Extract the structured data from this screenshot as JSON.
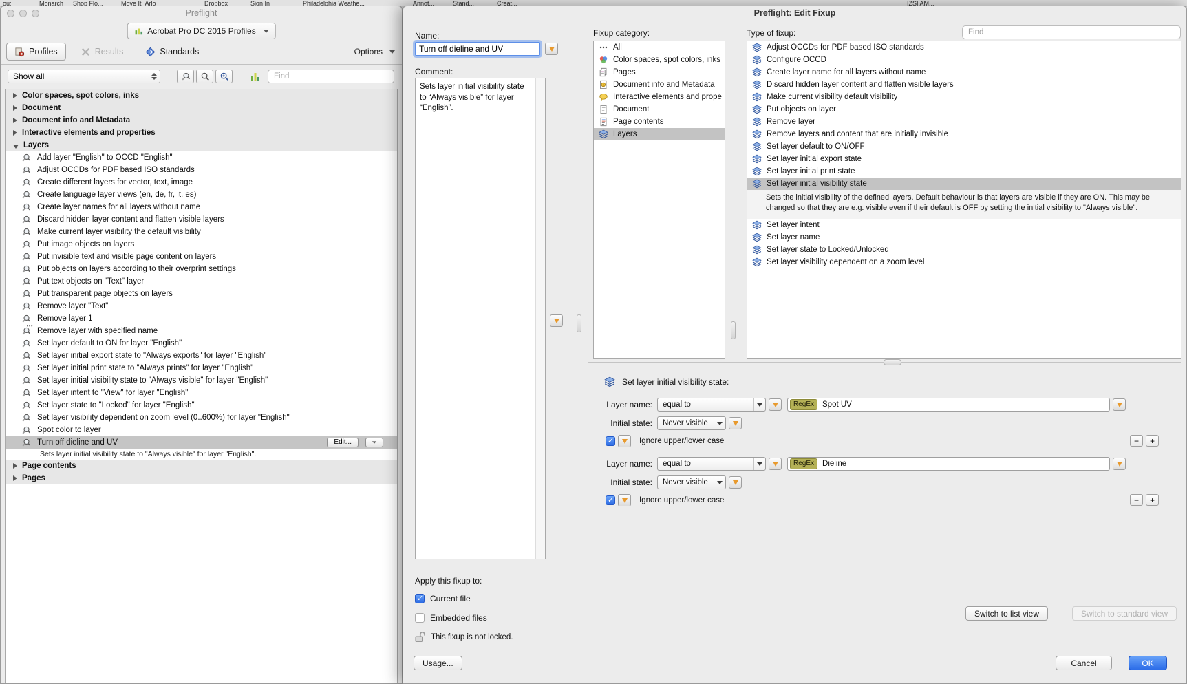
{
  "background": {
    "left_items": [
      "ou:",
      "Monarch",
      "Shop Flo...",
      "Move It_Arlo",
      "Dropbox",
      "Sign In",
      "Philadelphia Weathe..."
    ],
    "right_items": [
      "Annot...",
      "Stand...",
      "Creat...",
      "IZSI AM..."
    ]
  },
  "preflight_window": {
    "title": "Preflight",
    "profiles_dropdown_label": "Acrobat Pro DC 2015 Profiles",
    "tabs": [
      {
        "label": "Profiles"
      },
      {
        "label": "Results"
      },
      {
        "label": "Standards"
      }
    ],
    "options_label": "Options",
    "show_all_value": "Show all",
    "find_placeholder": "Find",
    "edit_button_label": "Edit...",
    "tree": [
      {
        "type": "category",
        "label": "Color spaces, spot colors, inks",
        "expanded": false
      },
      {
        "type": "category",
        "label": "Document",
        "expanded": false
      },
      {
        "type": "category",
        "label": "Document info and Metadata",
        "expanded": false
      },
      {
        "type": "category",
        "label": "Interactive elements and properties",
        "expanded": false
      },
      {
        "type": "category",
        "label": "Layers",
        "expanded": true
      },
      {
        "type": "item",
        "label": "Add layer \"English\" to OCCD \"English\""
      },
      {
        "type": "item",
        "label": "Adjust OCCDs for PDF based ISO standards"
      },
      {
        "type": "item",
        "label": "Create different layers for vector, text, image"
      },
      {
        "type": "item",
        "label": "Create language layer views (en, de, fr, it, es)"
      },
      {
        "type": "item",
        "label": "Create layer names for all layers without name"
      },
      {
        "type": "item",
        "label": "Discard hidden layer content and flatten visible layers"
      },
      {
        "type": "item",
        "label": "Make current layer visibility the default visibility"
      },
      {
        "type": "item",
        "label": "Put image objects on layers"
      },
      {
        "type": "item",
        "label": "Put invisible text and visible page content on layers"
      },
      {
        "type": "item",
        "label": "Put objects on layers according to their overprint settings"
      },
      {
        "type": "item",
        "label": "Put text objects on \"Text\" layer"
      },
      {
        "type": "item",
        "label": "Put transparent page objects on layers"
      },
      {
        "type": "item",
        "label": "Remove layer \"Text\""
      },
      {
        "type": "item",
        "label": "Remove layer 1"
      },
      {
        "type": "item",
        "label": "Remove layer with specified name",
        "dots": true
      },
      {
        "type": "item",
        "label": "Set layer default to ON for layer \"English\""
      },
      {
        "type": "item",
        "label": "Set layer initial export state to \"Always exports\" for layer \"English\""
      },
      {
        "type": "item",
        "label": "Set layer initial print state to \"Always prints\" for layer \"English\""
      },
      {
        "type": "item",
        "label": "Set layer initial visibility state to \"Always visible\" for layer \"English\""
      },
      {
        "type": "item",
        "label": "Set layer intent to \"View\" for layer \"English\""
      },
      {
        "type": "item",
        "label": "Set layer state to \"Locked\" for layer \"English\""
      },
      {
        "type": "item",
        "label": "Set layer visibility dependent on zoom level (0..600%) for layer \"English\""
      },
      {
        "type": "item",
        "label": "Spot color to layer"
      },
      {
        "type": "item",
        "label": "Turn off dieline and UV",
        "selected": true,
        "edit_button": true
      },
      {
        "type": "description",
        "label": "Sets layer initial visibility state to \"Always visible\" for layer \"English\"."
      },
      {
        "type": "category",
        "label": "Page contents",
        "expanded": false
      },
      {
        "type": "category",
        "label": "Pages",
        "expanded": false
      }
    ]
  },
  "dialog": {
    "title": "Preflight: Edit Fixup",
    "name_label": "Name:",
    "name_value": "Turn off dieline and UV",
    "comment_label": "Comment:",
    "comment_value": "Sets layer initial visibility state to “Always visible” for layer “English”.",
    "apply_label": "Apply this fixup to:",
    "apply_options": [
      {
        "label": "Current file",
        "checked": true
      },
      {
        "label": "Embedded files",
        "checked": false
      }
    ],
    "lock_text": "This fixup is not locked.",
    "usage_button": "Usage...",
    "category_label": "Fixup category:",
    "categories": [
      {
        "label": "All",
        "icon": "all-icon",
        "selected": false
      },
      {
        "label": "Color spaces, spot colors, inks",
        "icon": "color-spaces-icon",
        "selected": false
      },
      {
        "label": "Pages",
        "icon": "pages-icon",
        "selected": false
      },
      {
        "label": "Document info and Metadata",
        "icon": "doc-info-icon",
        "selected": false
      },
      {
        "label": "Interactive elements and properties",
        "icon": "interactive-icon",
        "selected": false
      },
      {
        "label": "Document",
        "icon": "document-icon",
        "selected": false
      },
      {
        "label": "Page contents",
        "icon": "page-contents-icon",
        "selected": false
      },
      {
        "label": "Layers",
        "icon": "layers-icon",
        "selected": true
      }
    ],
    "type_label": "Type of fixup:",
    "find_placeholder": "Find",
    "fixup_types": [
      {
        "label": "Adjust OCCDs for PDF based ISO standards"
      },
      {
        "label": "Configure OCCD"
      },
      {
        "label": "Create layer name for all layers without name"
      },
      {
        "label": "Discard hidden layer content and flatten visible layers"
      },
      {
        "label": "Make current visibility default visibility"
      },
      {
        "label": "Put objects on layer"
      },
      {
        "label": "Remove layer"
      },
      {
        "label": "Remove layers and content that are initially invisible"
      },
      {
        "label": "Set layer default to ON/OFF"
      },
      {
        "label": "Set layer initial export state"
      },
      {
        "label": "Set layer initial print state"
      },
      {
        "label": "Set layer initial visibility state",
        "selected": true,
        "description": "Sets the initial visibility of the defined layers. Default behaviour is that layers are visible if they are ON. This may be changed so that they are e.g. visible even if their default is OFF by setting the initial visibility to \"Always visible\"."
      },
      {
        "label": "Set layer intent"
      },
      {
        "label": "Set layer name"
      },
      {
        "label": "Set layer state to Locked/Unlocked"
      },
      {
        "label": "Set layer visibility dependent on a zoom level"
      }
    ],
    "params": {
      "title": "Set layer initial visibility state:",
      "groups": [
        {
          "layer_name_label": "Layer name:",
          "match_value": "equal to",
          "regex_badge": "RegEx",
          "pattern": "Spot UV",
          "initial_state_label": "Initial state:",
          "initial_state_value": "Never visible",
          "ignore_case_label": "Ignore upper/lower case",
          "ignore_case_checked": true
        },
        {
          "layer_name_label": "Layer name:",
          "match_value": "equal to",
          "regex_badge": "RegEx",
          "pattern": "Dieline",
          "initial_state_label": "Initial state:",
          "initial_state_value": "Never visible",
          "ignore_case_label": "Ignore upper/lower case",
          "ignore_case_checked": true
        }
      ],
      "remove_label": "−",
      "add_label": "+"
    },
    "switch_list_button": "Switch to list view",
    "switch_standard_button": "Switch to standard view",
    "cancel_button": "Cancel",
    "ok_button": "OK"
  },
  "colors": {
    "accent_blue": "#2c6de8",
    "selection_gray": "#c3c3c3",
    "regex_badge_bg": "#b4b156",
    "dropdown_arrow_orange": "#e8992c"
  }
}
